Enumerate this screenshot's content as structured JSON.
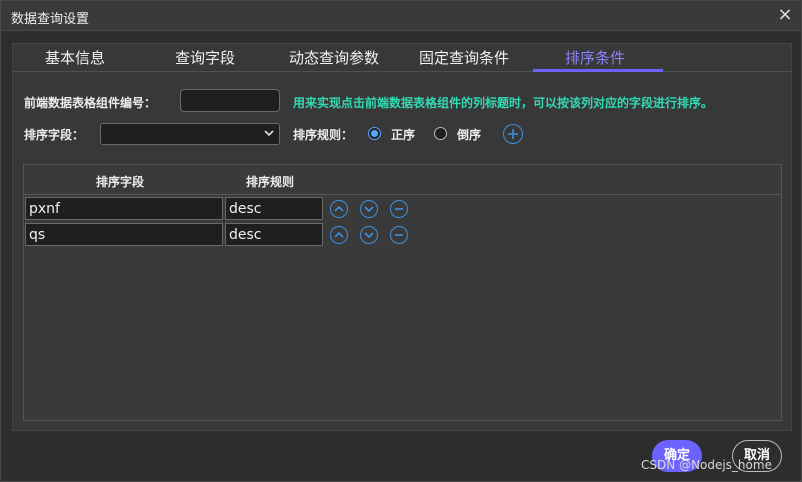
{
  "window": {
    "title": "数据查询设置",
    "close_glyph": "×"
  },
  "tabs": [
    {
      "label": "基本信息",
      "active": false
    },
    {
      "label": "查询字段",
      "active": false
    },
    {
      "label": "动态查询参数",
      "active": false
    },
    {
      "label": "固定查询条件",
      "active": false
    },
    {
      "label": "排序条件",
      "active": true
    }
  ],
  "form": {
    "component_id_label": "前端数据表格组件编号：",
    "component_id_value": "",
    "hint": "用来实现点击前端数据表格组件的列标题时，可以按该列对应的字段进行排序。",
    "sort_field_label": "排序字段：",
    "sort_field_value": "",
    "sort_rule_label": "排序规则：",
    "rule_options": [
      {
        "label": "正序",
        "checked": true
      },
      {
        "label": "倒序",
        "checked": false
      }
    ],
    "add_icon": "plus-circle-icon"
  },
  "grid": {
    "columns": [
      "排序字段",
      "排序规则"
    ],
    "rows": [
      {
        "field": "pxnf",
        "rule": "desc"
      },
      {
        "field": "qs",
        "rule": "desc"
      }
    ]
  },
  "footer": {
    "ok_label": "确定",
    "cancel_label": "取消",
    "watermark": "CSDN @Nodejs_home"
  },
  "colors": {
    "accent": "#6c63ff",
    "icon_blue": "#3d8fe0",
    "hint_text": "#33d9b2"
  }
}
